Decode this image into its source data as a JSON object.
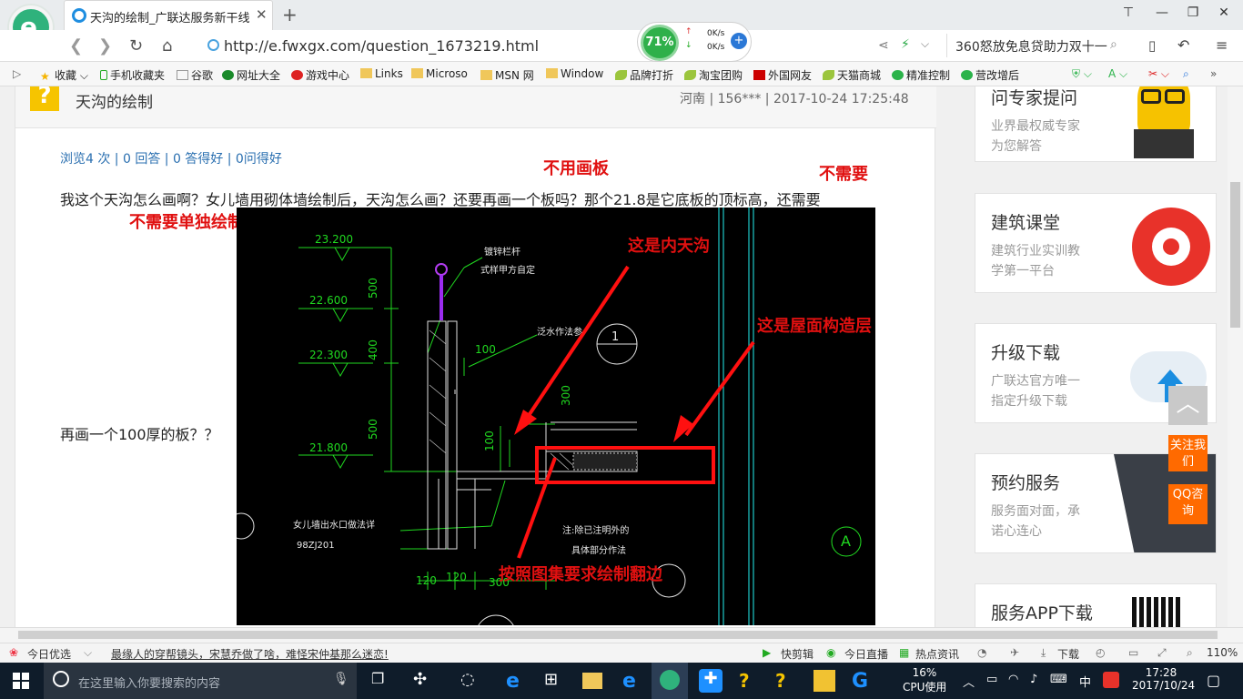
{
  "browser": {
    "tab_title": "天沟的绘制_广联达服务新干线",
    "url": "http://e.fwxgx.com/question_1673219.html",
    "speed_percent": "71%",
    "speed_up": "0K/s",
    "speed_down": "0K/s",
    "search_text": "360怒放免息贷助力双十一",
    "bookmarks": [
      "收藏",
      "手机收藏夹",
      "谷歌",
      "网址大全",
      "游戏中心",
      "Links",
      "Microso",
      "MSN 网",
      "Window",
      "品牌打折",
      "淘宝团购",
      "外国网友",
      "天猫商城",
      "精准控制",
      "营改增后"
    ]
  },
  "question": {
    "title": "天沟的绘制",
    "meta": "河南 | 156*** | 2017-10-24 17:25:48",
    "stats": "浏览4 次 | 0 回答 | 0 答得好 | 0问得好",
    "text_line1": "我这个天沟怎么画啊？女儿墙用砌体墙绘制后，天沟怎么画？还要再画一个板吗？那个21.8是它底板的顶标高，还需要",
    "text_line2": "再画一个100厚的板？？"
  },
  "annotations": {
    "a1": "不用画板",
    "a2": "不需要",
    "a3": "不需要单独绘制",
    "a4": "这是内天沟",
    "a5": "这是屋面构造层",
    "a6": "按照图集要求绘制翻边"
  },
  "drawing": {
    "elev1": "23.200",
    "elev2": "22.600",
    "elev3": "22.300",
    "elev4": "21.800",
    "dim500a": "500",
    "dim400": "400",
    "dim500b": "500",
    "dim100a": "100",
    "dim300": "300",
    "dim100b": "100",
    "dim120a": "120",
    "dim120b": "120",
    "dim300b": "300",
    "note_rail1": "镀锌栏杆",
    "note_rail2": "式样甲方自定",
    "note_waterproof": "泛水作法参",
    "note_outlet": "女儿墙出水口做法详",
    "note_ref": "98ZJ201",
    "note_other1": "注:除已注明外的",
    "note_other2": "具体部分作法",
    "circle1": "1",
    "circleA": "A"
  },
  "sidebar": {
    "cards": [
      {
        "title": "问专家提问",
        "d1": "业界最权威专家",
        "d2": "为您解答"
      },
      {
        "title": "建筑课堂",
        "d1": "建筑行业实训教",
        "d2": "学第一平台"
      },
      {
        "title": "升级下载",
        "d1": "广联达官方唯一",
        "d2": "指定升级下载"
      },
      {
        "title": "预约服务",
        "d1": "服务面对面，承",
        "d2": "诺心连心"
      },
      {
        "title": "服务APP下载",
        "d1": "",
        "d2": ""
      }
    ],
    "follow": "关注我们",
    "qq": "QQ咨询"
  },
  "statusbar": {
    "today": "今日优选",
    "news": "最缘人的穿帮镜头，宋慧乔做了啥，难怪宋仲基那么迷恋!",
    "kuaijian": "快剪辑",
    "zhibo": "今日直播",
    "redian": "热点资讯",
    "download": "下载",
    "zoom": "110%"
  },
  "taskbar": {
    "search_placeholder": "在这里输入你要搜索的内容",
    "cpu": "16%",
    "cpu_label": "CPU使用",
    "ime": "中",
    "time": "17:28",
    "date": "2017/10/24"
  },
  "colors": {
    "accent": "#2a6fb0",
    "annotation": "#e01010",
    "cad_green": "#22e022"
  }
}
